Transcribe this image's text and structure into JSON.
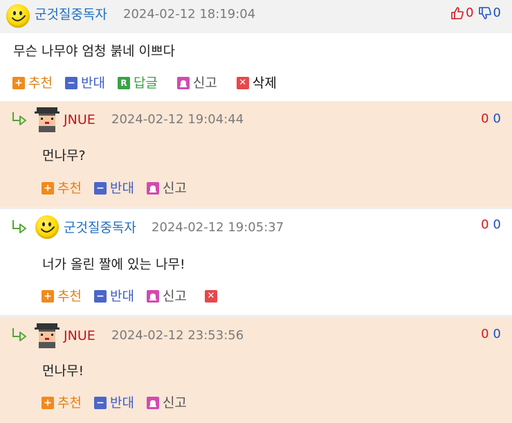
{
  "main_comment": {
    "author": "군것질중독자",
    "date": "2024-02-12 18:19:04",
    "text": "무슨 나무야 엄청 붉네 이쁘다",
    "up_count": "0",
    "down_count": "0",
    "actions": {
      "recommend": "추천",
      "oppose": "반대",
      "reply": "답글",
      "report": "신고",
      "delete": "삭제"
    }
  },
  "replies": [
    {
      "author": "JNUE",
      "date": "2024-02-12 19:04:44",
      "text": "먼나무?",
      "up_count": "0",
      "down_count": "0",
      "actions": {
        "recommend": "추천",
        "oppose": "반대",
        "report": "신고"
      }
    },
    {
      "author": "군것질중독자",
      "date": "2024-02-12 19:05:37",
      "text": "너가 올린 짤에 있는 나무!",
      "up_count": "0",
      "down_count": "0",
      "actions": {
        "recommend": "추천",
        "oppose": "반대",
        "report": "신고"
      }
    },
    {
      "author": "JNUE",
      "date": "2024-02-12 23:53:56",
      "text": "먼나무!",
      "up_count": "0",
      "down_count": "0",
      "actions": {
        "recommend": "추천",
        "oppose": "반대",
        "report": "신고"
      }
    }
  ],
  "icons": {
    "avatar_smiley": "smiley-avatar-icon",
    "avatar_pixel": "pixel-avatar-icon",
    "reply_arrow": "reply-arrow-icon",
    "thumbs_up": "thumbs-up-icon",
    "thumbs_down": "thumbs-down-icon"
  },
  "colors": {
    "peach_bg": "#fbe7d6",
    "header_bg": "#f2f2f2",
    "nick_blue": "#1e6fc2",
    "nick_red": "#c0161a",
    "vote_up": "#d4171d",
    "vote_down": "#1e4fc2"
  }
}
